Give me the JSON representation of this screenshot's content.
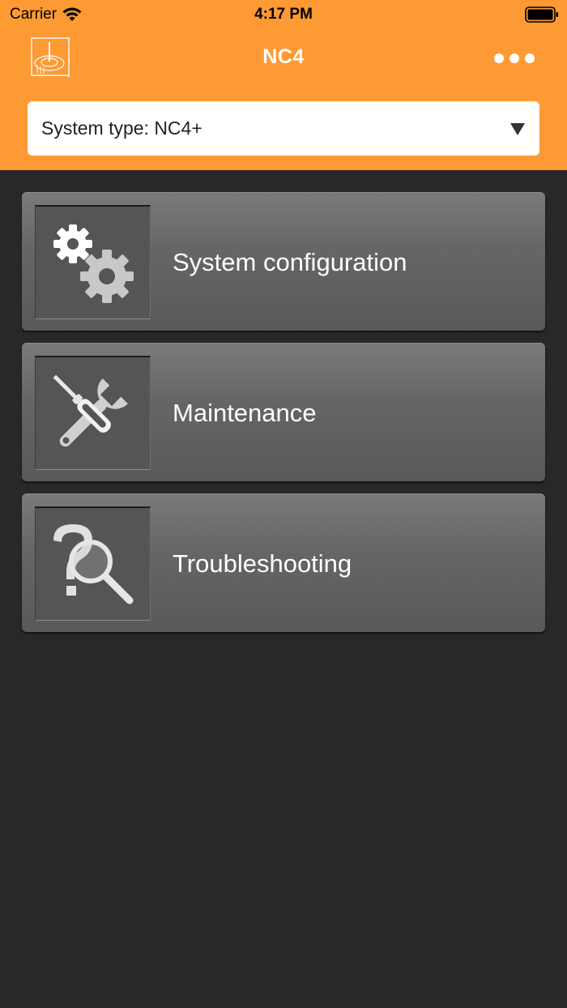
{
  "status_bar": {
    "carrier": "Carrier",
    "time": "4:17 PM"
  },
  "nav": {
    "title": "NC4"
  },
  "system_type": {
    "label": "System type: NC4+"
  },
  "menu": {
    "items": [
      {
        "label": "System configuration",
        "icon": "gears-icon"
      },
      {
        "label": "Maintenance",
        "icon": "wrench-screwdriver-icon"
      },
      {
        "label": "Troubleshooting",
        "icon": "question-magnifier-icon"
      }
    ]
  },
  "colors": {
    "header": "#fd9a34",
    "background": "#282828",
    "tile": "#666666"
  }
}
